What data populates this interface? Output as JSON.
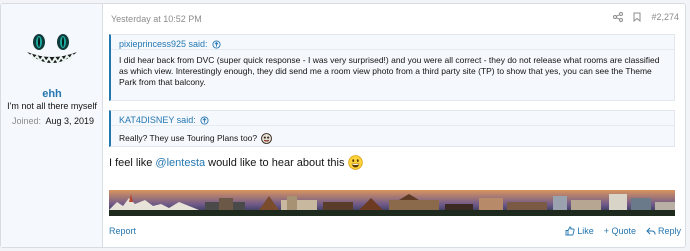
{
  "user": {
    "name": "ehh",
    "title": "I'm not all there myself",
    "joined_label": "Joined:",
    "joined_value": "Aug 3, 2019"
  },
  "post": {
    "date": "Yesterday at 10:52 PM",
    "number": "#2,274"
  },
  "quotes": [
    {
      "author": "pixieprincess925 said:",
      "text": "I did hear back from DVC (super quick response - I was very surprised!) and you were all correct - they do not release what rooms are classified as which view. Interestingly enough, they did send me a room view photo from a third party site (TP) to show that yes, you can see the Theme Park from that balcony."
    },
    {
      "author": "KAT4DISNEY said:",
      "text": "Really? They use Touring Plans too?"
    }
  ],
  "message": {
    "before": "I feel like",
    "mention": "@lentesta",
    "after": "would like to hear about this"
  },
  "footer": {
    "report": "Report",
    "like": "Like",
    "quote": "+ Quote",
    "reply": "Reply"
  },
  "colors": {
    "link": "#2577b1",
    "muted": "#8c8c8c",
    "quote_bg": "#f5f8fc"
  }
}
